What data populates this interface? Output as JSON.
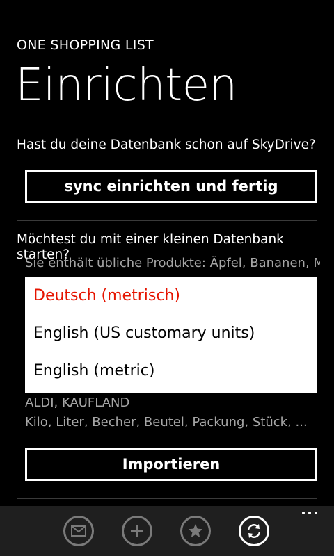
{
  "header": {
    "app_title": "ONE SHOPPING LIST",
    "page_title": "Einrichten"
  },
  "sync_section": {
    "question": "Hast du deine Datenbank schon auf SkyDrive?",
    "button_label": "sync einrichten und fertig"
  },
  "database_section": {
    "question": "Möchtest du mit einer kleinen Datenbank starten?",
    "description": "Sie enthält übliche Produkte: Äpfel, Bananen, Mi",
    "options": [
      {
        "label": "Deutsch (metrisch)",
        "selected": true
      },
      {
        "label": "English (US customary units)",
        "selected": false
      },
      {
        "label": "English (metric)",
        "selected": false
      }
    ],
    "stores": "ALDI, KAUFLAND",
    "units": "Kilo, Liter, Becher, Beutel, Packung, Stück, ...",
    "import_label": "Importieren"
  },
  "app_bar": {
    "buttons": [
      {
        "icon": "mail-icon"
      },
      {
        "icon": "add-icon"
      },
      {
        "icon": "star-icon"
      },
      {
        "icon": "sync-icon"
      }
    ],
    "more_icon": "more-icon"
  },
  "colors": {
    "background": "#000000",
    "accent": "#e51400",
    "app_bar": "#1f1f1f",
    "secondary_text": "#a6a6a6"
  }
}
